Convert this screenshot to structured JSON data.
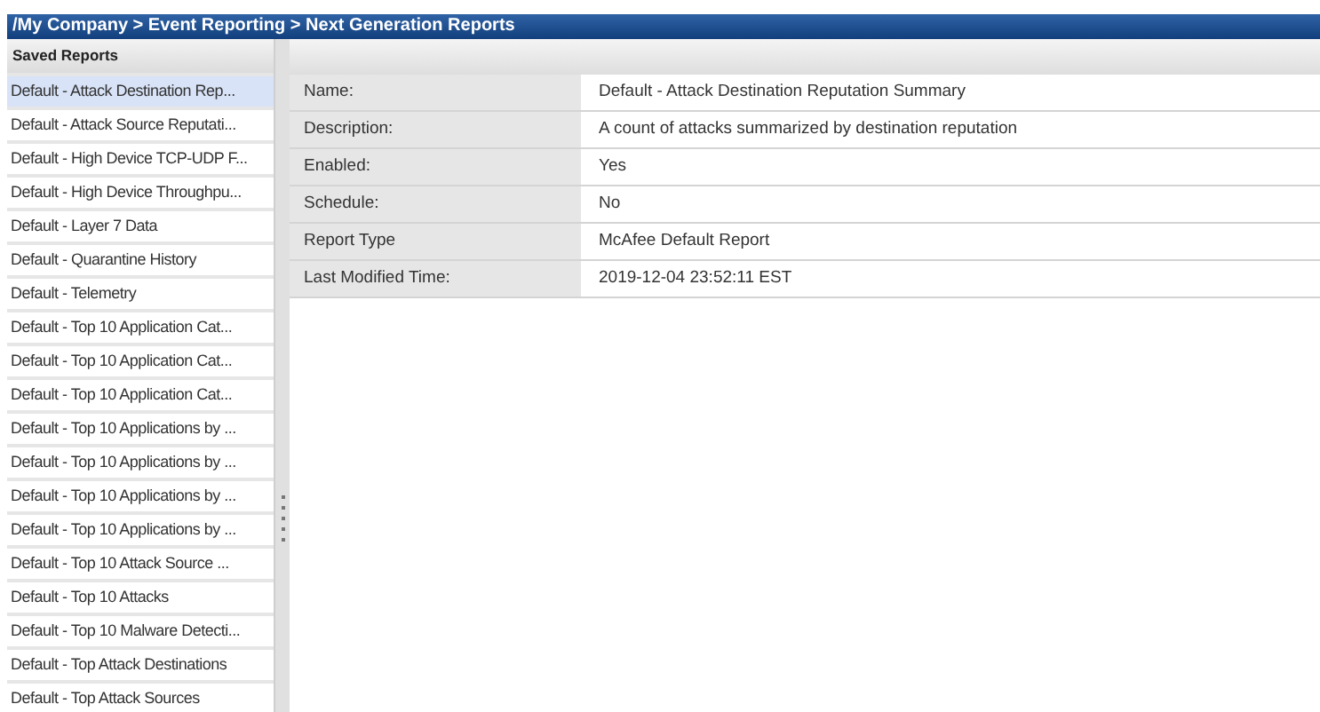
{
  "breadcrumb": "/My Company > Event Reporting > Next Generation Reports",
  "saved_reports": {
    "title": "Saved Reports",
    "items": [
      {
        "label": "Default - Attack Destination Rep...",
        "selected": true
      },
      {
        "label": "Default - Attack Source Reputati...",
        "selected": false
      },
      {
        "label": "Default - High Device TCP-UDP F...",
        "selected": false
      },
      {
        "label": "Default - High Device Throughpu...",
        "selected": false
      },
      {
        "label": "Default - Layer 7 Data",
        "selected": false
      },
      {
        "label": "Default - Quarantine History",
        "selected": false
      },
      {
        "label": "Default - Telemetry",
        "selected": false
      },
      {
        "label": "Default - Top 10 Application Cat...",
        "selected": false
      },
      {
        "label": "Default - Top 10 Application Cat...",
        "selected": false
      },
      {
        "label": "Default - Top 10 Application Cat...",
        "selected": false
      },
      {
        "label": "Default - Top 10 Applications by ...",
        "selected": false
      },
      {
        "label": "Default - Top 10 Applications by ...",
        "selected": false
      },
      {
        "label": "Default - Top 10 Applications by ...",
        "selected": false
      },
      {
        "label": "Default - Top 10 Applications by ...",
        "selected": false
      },
      {
        "label": "Default - Top 10 Attack Source ...",
        "selected": false
      },
      {
        "label": "Default - Top 10 Attacks",
        "selected": false
      },
      {
        "label": "Default - Top 10 Malware Detecti...",
        "selected": false
      },
      {
        "label": "Default - Top Attack Destinations",
        "selected": false
      },
      {
        "label": "Default - Top Attack Sources",
        "selected": false
      }
    ]
  },
  "details": [
    {
      "label": "Name:",
      "value": "Default - Attack Destination Reputation Summary"
    },
    {
      "label": "Description:",
      "value": "A count of attacks summarized by destination reputation"
    },
    {
      "label": "Enabled:",
      "value": "Yes"
    },
    {
      "label": "Schedule:",
      "value": "No"
    },
    {
      "label": "Report Type",
      "value": "McAfee Default Report"
    },
    {
      "label": "Last Modified Time:",
      "value": "2019-12-04 23:52:11 EST"
    }
  ]
}
